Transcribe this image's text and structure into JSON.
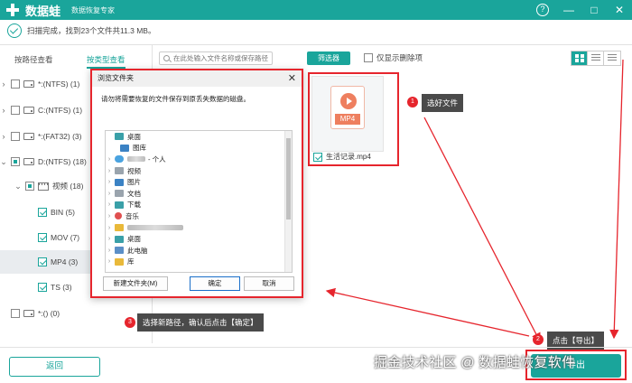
{
  "app": {
    "brand": "数据蛙",
    "subtitle": "数据恢复专家"
  },
  "window_controls": {
    "help": "?",
    "minimize": "—",
    "maximize": "□",
    "close": "✕"
  },
  "status": {
    "text": "扫描完成，找到23个文件共11.3 MB。"
  },
  "tabs": [
    {
      "label": "按路径查看",
      "active": false
    },
    {
      "label": "按类型查看",
      "active": true
    }
  ],
  "tree": {
    "nodes": [
      {
        "label": "*:(NTFS) (1)"
      },
      {
        "label": "C:(NTFS) (1)"
      },
      {
        "label": "*:(FAT32) (3)"
      },
      {
        "label": "D:(NTFS) (18)"
      },
      {
        "label": "视频 (18)"
      },
      {
        "label": "BIN (5)"
      },
      {
        "label": "MOV (7)"
      },
      {
        "label": "MP4 (3)"
      },
      {
        "label": "TS (3)"
      },
      {
        "label": "*:() (0)"
      }
    ]
  },
  "toolbar": {
    "search_placeholder": "在此处输入文件名称或保存路径",
    "filter_label": "筛选器",
    "only_deleted_label": "仅显示删除项"
  },
  "file": {
    "icon_text": "MP4",
    "name": "生活记录.mp4",
    "checked": true
  },
  "dialog": {
    "title": "浏览文件夹",
    "message": "请勿将需要恢复的文件保存到原丢失数据的磁盘。",
    "items": [
      {
        "label": "桌面"
      },
      {
        "label": "图库"
      },
      {
        "label": "- 个人"
      },
      {
        "label": "视频"
      },
      {
        "label": "图片"
      },
      {
        "label": "文档"
      },
      {
        "label": "下载"
      },
      {
        "label": "音乐"
      },
      {
        "label": "桌面"
      },
      {
        "label": "此电脑"
      },
      {
        "label": "库"
      }
    ],
    "new_folder_label": "新建文件夹(M)",
    "ok_label": "确定",
    "cancel_label": "取消",
    "close": "✕"
  },
  "annotations": {
    "step1": {
      "num": "1",
      "text": "选好文件"
    },
    "step2": {
      "num": "2",
      "text": "点击【导出】"
    },
    "step3": {
      "num": "3",
      "text": "选择新路径，确认后点击【确定】"
    }
  },
  "bottom": {
    "back_label": "返回",
    "export_label": "导出"
  },
  "watermark": "掘金技术社区 @ 数据蛙恢复软件",
  "colors": {
    "accent": "#1aa59b",
    "annotation_red": "#e6252d",
    "mp4_orange": "#ee7f5f"
  }
}
